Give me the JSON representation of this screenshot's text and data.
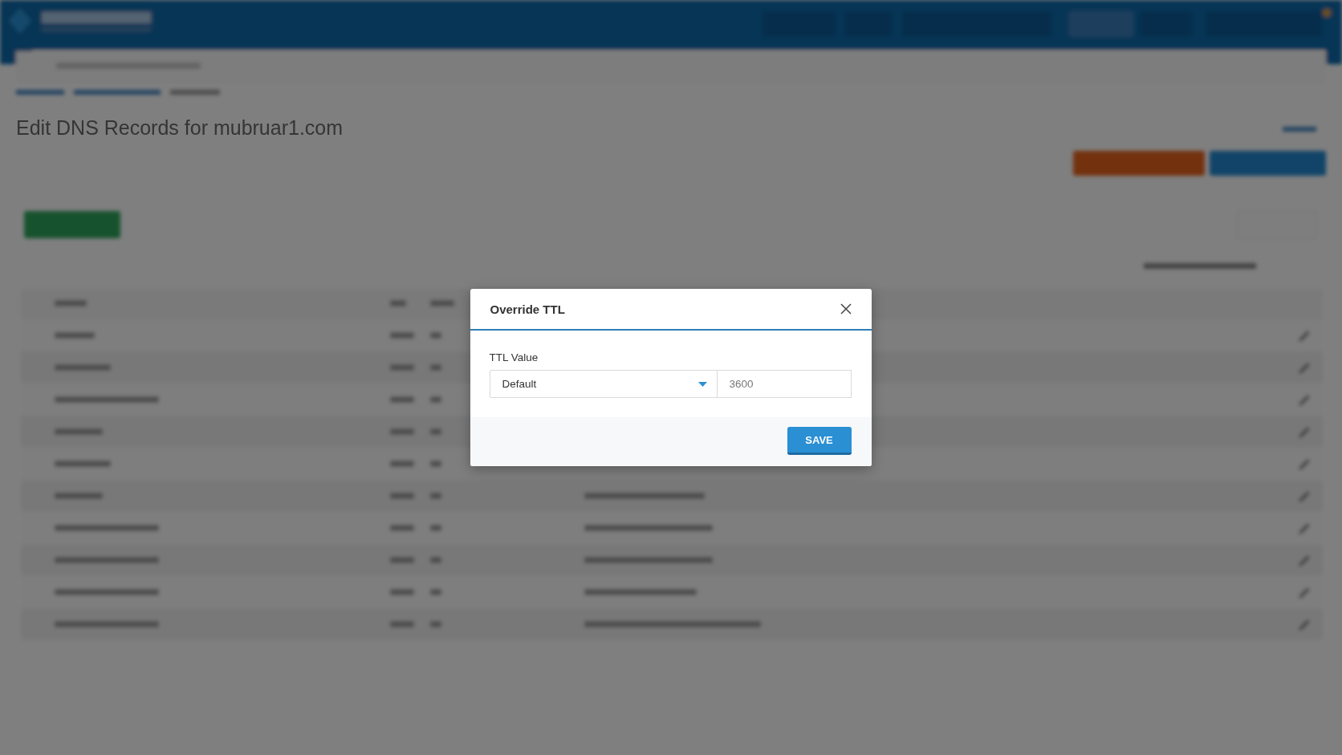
{
  "page": {
    "heading": "Edit DNS Records for mubruar1.com"
  },
  "dialog": {
    "title": "Override TTL",
    "field_label": "TTL Value",
    "select": {
      "value": "Default"
    },
    "ttl_input": {
      "value": "3600",
      "disabled": true
    },
    "buttons": [
      {
        "label": "SAVE"
      }
    ]
  }
}
